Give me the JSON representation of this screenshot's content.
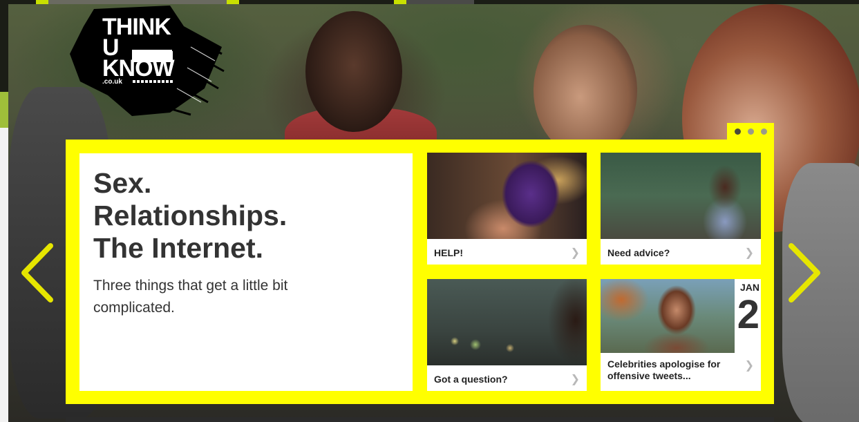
{
  "logo": {
    "line1": "THINK",
    "line2": "U",
    "line3": "KNOW",
    "domain": ".co.uk"
  },
  "hero": {
    "headline_lines": [
      "Sex.",
      "Relationships.",
      "The Internet."
    ],
    "subtext": "Three things that get a little bit complicated."
  },
  "carousel": {
    "slide_count": 3,
    "active_slide": 1,
    "prev_icon": "chevron-left-icon",
    "next_icon": "chevron-right-icon"
  },
  "cards": [
    {
      "label": "HELP!",
      "icon": "chevron-right-icon"
    },
    {
      "label": "Need advice?",
      "icon": "chevron-right-icon"
    },
    {
      "label": "Got a question?",
      "icon": "chevron-right-icon"
    },
    {
      "label": "Celebrities apologise for offensive tweets...",
      "icon": "chevron-right-icon",
      "date_month": "JAN",
      "date_day": "2"
    }
  ],
  "colors": {
    "accent": "#ffff00",
    "text": "#333333",
    "arrow": "#e6e600"
  }
}
